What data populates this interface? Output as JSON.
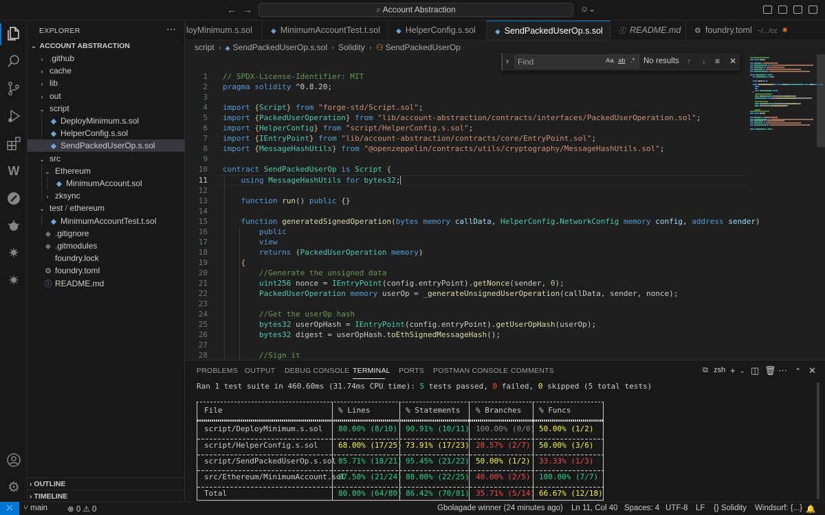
{
  "window": {
    "search_label": "Account Abstraction",
    "copilot_icon": "copilot-icon"
  },
  "activity_bar": [
    "files-icon",
    "search-icon",
    "source-control-icon",
    "run-debug-icon",
    "extensions-icon",
    "windsurf-icon",
    "foundry-icon",
    "remote-explorer-icon",
    "sparkle-icon",
    "sparkle-icon-2",
    "account-icon",
    "settings-gear-icon"
  ],
  "sidebar": {
    "title": "EXPLORER",
    "root": "ACCOUNT ABSTRACTION",
    "items": [
      {
        "label": ".github",
        "kind": "folder",
        "expanded": false,
        "depth": 0
      },
      {
        "label": "cache",
        "kind": "folder",
        "expanded": false,
        "depth": 0
      },
      {
        "label": "lib",
        "kind": "folder",
        "expanded": false,
        "depth": 0
      },
      {
        "label": "out",
        "kind": "folder",
        "expanded": false,
        "depth": 0
      },
      {
        "label": "script",
        "kind": "folder",
        "expanded": true,
        "depth": 0
      },
      {
        "label": "DeployMinimum.s.sol",
        "kind": "sol",
        "depth": 1
      },
      {
        "label": "HelperConfig.s.sol",
        "kind": "sol",
        "depth": 1
      },
      {
        "label": "SendPackedUserOp.s.sol",
        "kind": "sol",
        "depth": 1,
        "selected": true
      },
      {
        "label": "src",
        "kind": "folder",
        "expanded": true,
        "depth": 0
      },
      {
        "label": "Ethereum",
        "kind": "folder",
        "expanded": true,
        "depth": 1
      },
      {
        "label": "MinimumAccount.sol",
        "kind": "sol",
        "depth": 2
      },
      {
        "label": "zksync",
        "kind": "folder",
        "expanded": false,
        "depth": 1
      },
      {
        "label": "test",
        "label2": "ethereum",
        "kind": "folder",
        "expanded": true,
        "depth": 0
      },
      {
        "label": "MinimumAccountTest.t.sol",
        "kind": "sol",
        "depth": 1
      },
      {
        "label": ".gitignore",
        "kind": "git",
        "depth": 0
      },
      {
        "label": ".gitmodules",
        "kind": "git",
        "depth": 0
      },
      {
        "label": "foundry.lock",
        "kind": "plain",
        "depth": 0
      },
      {
        "label": "foundry.toml",
        "kind": "gear",
        "depth": 0
      },
      {
        "label": "README.md",
        "kind": "info",
        "depth": 0
      }
    ],
    "outline_label": "OUTLINE",
    "timeline_label": "TIMELINE"
  },
  "tabs": [
    {
      "label": "loyMinimum.s.sol",
      "icon": "solidity-icon",
      "active": false
    },
    {
      "label": "MinimumAccountTest.t.sol",
      "icon": "solidity-icon",
      "active": false
    },
    {
      "label": "HelperConfig.s.sol",
      "icon": "solidity-icon",
      "active": false
    },
    {
      "label": "SendPackedUserOp.s.sol",
      "icon": "solidity-icon",
      "active": true
    },
    {
      "label": "README.md",
      "icon": "info-icon",
      "active": false,
      "italic": true
    },
    {
      "label": "foundry.toml",
      "suffix": "~/.../cc",
      "icon": "gear-icon",
      "active": false
    }
  ],
  "breadcrumbs": [
    "script",
    "SendPackedUserOp.s.sol",
    "Solidity",
    "SendPackedUserOp"
  ],
  "find": {
    "placeholder": "Find",
    "result": "No results",
    "options": [
      "Aa",
      "ab",
      ".*"
    ]
  },
  "editor": {
    "current_line": 11,
    "lines": [
      [
        [
          "c",
          "// SPDX-License-Identifier: MIT"
        ]
      ],
      [
        [
          "k",
          "pragma"
        ],
        [
          "p",
          " "
        ],
        [
          "k",
          "solidity"
        ],
        [
          "p",
          " ^0.8.20;"
        ]
      ],
      [],
      [
        [
          "k",
          "import"
        ],
        [
          "p",
          " "
        ],
        [
          "b",
          "{"
        ],
        [
          "t",
          "Script"
        ],
        [
          "b",
          "}"
        ],
        [
          "p",
          " "
        ],
        [
          "k",
          "from"
        ],
        [
          "p",
          " "
        ],
        [
          "s",
          "\"forge-std/Script.sol\""
        ],
        [
          "p",
          ";"
        ]
      ],
      [
        [
          "k",
          "import"
        ],
        [
          "p",
          " "
        ],
        [
          "b",
          "{"
        ],
        [
          "t",
          "PackedUserOperation"
        ],
        [
          "b",
          "}"
        ],
        [
          "p",
          " "
        ],
        [
          "k",
          "from"
        ],
        [
          "p",
          " "
        ],
        [
          "s",
          "\"lib/account-abstraction/contracts/interfaces/PackedUserOperation.sol\""
        ],
        [
          "p",
          ";"
        ]
      ],
      [
        [
          "k",
          "import"
        ],
        [
          "p",
          " "
        ],
        [
          "b",
          "{"
        ],
        [
          "t",
          "HelperConfig"
        ],
        [
          "b",
          "}"
        ],
        [
          "p",
          " "
        ],
        [
          "k",
          "from"
        ],
        [
          "p",
          " "
        ],
        [
          "s",
          "\"script/HelperConfig.s.sol\""
        ],
        [
          "p",
          ";"
        ]
      ],
      [
        [
          "k",
          "import"
        ],
        [
          "p",
          " "
        ],
        [
          "b",
          "{"
        ],
        [
          "t",
          "IEntryPoint"
        ],
        [
          "b",
          "}"
        ],
        [
          "p",
          " "
        ],
        [
          "k",
          "from"
        ],
        [
          "p",
          " "
        ],
        [
          "s",
          "\"lib/account-abstraction/contracts/core/EntryPoint.sol\""
        ],
        [
          "p",
          ";"
        ]
      ],
      [
        [
          "k",
          "import"
        ],
        [
          "p",
          " "
        ],
        [
          "b",
          "{"
        ],
        [
          "t",
          "MessageHashUtils"
        ],
        [
          "b",
          "}"
        ],
        [
          "p",
          " "
        ],
        [
          "k",
          "from"
        ],
        [
          "p",
          " "
        ],
        [
          "s",
          "\"@openzeppelin/contracts/utils/cryptography/MessageHashUtils.sol\""
        ],
        [
          "p",
          ";"
        ]
      ],
      [],
      [
        [
          "k",
          "contract"
        ],
        [
          "p",
          " "
        ],
        [
          "t",
          "SendPackedUserOp"
        ],
        [
          "p",
          " "
        ],
        [
          "k",
          "is"
        ],
        [
          "p",
          " "
        ],
        [
          "t",
          "Script"
        ],
        [
          "p",
          " "
        ],
        [
          "b",
          "{"
        ]
      ],
      [
        [
          "p",
          "    "
        ],
        [
          "k",
          "using"
        ],
        [
          "p",
          " "
        ],
        [
          "t",
          "MessageHashUtils"
        ],
        [
          "p",
          " "
        ],
        [
          "k",
          "for"
        ],
        [
          "p",
          " "
        ],
        [
          "t",
          "bytes32"
        ],
        [
          "p",
          ";"
        ]
      ],
      [],
      [
        [
          "p",
          "    "
        ],
        [
          "k",
          "function"
        ],
        [
          "p",
          " "
        ],
        [
          "f",
          "run"
        ],
        [
          "p",
          "() "
        ],
        [
          "k",
          "public"
        ],
        [
          "p",
          " {}"
        ]
      ],
      [],
      [
        [
          "p",
          "    "
        ],
        [
          "k",
          "function"
        ],
        [
          "p",
          " "
        ],
        [
          "f",
          "generatedSignedOperation"
        ],
        [
          "p",
          "("
        ],
        [
          "k",
          "bytes"
        ],
        [
          "p",
          " "
        ],
        [
          "k",
          "memory"
        ],
        [
          "p",
          " "
        ],
        [
          "v",
          "callData"
        ],
        [
          "p",
          ", "
        ],
        [
          "t",
          "HelperConfig"
        ],
        [
          "p",
          "."
        ],
        [
          "t",
          "NetworkConfig"
        ],
        [
          "p",
          " "
        ],
        [
          "k",
          "memory"
        ],
        [
          "p",
          " "
        ],
        [
          "v",
          "config"
        ],
        [
          "p",
          ", "
        ],
        [
          "k",
          "address"
        ],
        [
          "p",
          " "
        ],
        [
          "v",
          "sender"
        ],
        [
          "p",
          ")"
        ]
      ],
      [
        [
          "p",
          "        "
        ],
        [
          "k",
          "public"
        ]
      ],
      [
        [
          "p",
          "        "
        ],
        [
          "k",
          "view"
        ]
      ],
      [
        [
          "p",
          "        "
        ],
        [
          "k",
          "returns"
        ],
        [
          "p",
          " ("
        ],
        [
          "t",
          "PackedUserOperation"
        ],
        [
          "p",
          " "
        ],
        [
          "k",
          "memory"
        ],
        [
          "p",
          ")"
        ]
      ],
      [
        [
          "p",
          "    "
        ],
        [
          "b",
          "{"
        ]
      ],
      [
        [
          "p",
          "        "
        ],
        [
          "c",
          "//Generate the unsigned data"
        ]
      ],
      [
        [
          "p",
          "        "
        ],
        [
          "t",
          "uint256"
        ],
        [
          "p",
          " nonce = "
        ],
        [
          "t",
          "IEntryPoint"
        ],
        [
          "p",
          "(config.entryPoint)."
        ],
        [
          "f",
          "getNonce"
        ],
        [
          "p",
          "(sender, "
        ],
        [
          "n",
          "0"
        ],
        [
          "p",
          ");"
        ]
      ],
      [
        [
          "p",
          "        "
        ],
        [
          "t",
          "PackedUserOperation"
        ],
        [
          "p",
          " "
        ],
        [
          "k",
          "memory"
        ],
        [
          "p",
          " userOp = "
        ],
        [
          "f",
          "_generateUnsignedUserOperation"
        ],
        [
          "p",
          "(callData, sender, nonce);"
        ]
      ],
      [],
      [
        [
          "p",
          "        "
        ],
        [
          "c",
          "//Get the userOp hash"
        ]
      ],
      [
        [
          "p",
          "        "
        ],
        [
          "t",
          "bytes32"
        ],
        [
          "p",
          " userOpHash = "
        ],
        [
          "t",
          "IEntryPoint"
        ],
        [
          "p",
          "(config.entryPoint)."
        ],
        [
          "f",
          "getUserOpHash"
        ],
        [
          "p",
          "(userOp);"
        ]
      ],
      [
        [
          "p",
          "        "
        ],
        [
          "t",
          "bytes32"
        ],
        [
          "p",
          " digest = userOpHash."
        ],
        [
          "f",
          "toEthSignedMessageHash"
        ],
        [
          "p",
          "();"
        ]
      ],
      [],
      [
        [
          "p",
          "        "
        ],
        [
          "c",
          "//Sign it"
        ]
      ]
    ]
  },
  "panel": {
    "tabs": [
      "PROBLEMS",
      "OUTPUT",
      "DEBUG CONSOLE",
      "TERMINAL",
      "PORTS",
      "POSTMAN CONSOLE",
      "COMMENTS"
    ],
    "active_tab": "TERMINAL",
    "shell": "zsh",
    "summary_parts": [
      [
        "p",
        "Ran 1 test suite in 460.60ms (31.74ms CPU time): "
      ],
      [
        "g",
        "5"
      ],
      [
        "p",
        " tests passed, "
      ],
      [
        "r",
        "0"
      ],
      [
        "p",
        " failed, "
      ],
      [
        "y",
        "0"
      ],
      [
        "p",
        " skipped (5 total tests)"
      ]
    ],
    "coverage": {
      "headers": [
        "File",
        "% Lines",
        "% Statements",
        "% Branches",
        "% Funcs"
      ],
      "rows": [
        {
          "file": "script/DeployMinimum.s.sol",
          "cells": [
            [
              "80.00% (8/10)",
              "g"
            ],
            [
              "90.91% (10/11)",
              "g"
            ],
            [
              "100.00% (0/0)",
              "x"
            ],
            [
              "50.00% (1/2)",
              "y"
            ]
          ]
        },
        {
          "file": "script/HelperConfig.s.sol",
          "cells": [
            [
              "68.00% (17/25)",
              "y"
            ],
            [
              "73.91% (17/23)",
              "y"
            ],
            [
              "28.57% (2/7)",
              "r"
            ],
            [
              "50.00% (3/6)",
              "y"
            ]
          ]
        },
        {
          "file": "script/SendPackedUserOp.s.sol",
          "cells": [
            [
              "85.71% (18/21)",
              "g"
            ],
            [
              "95.45% (21/22)",
              "g"
            ],
            [
              "50.00% (1/2)",
              "y"
            ],
            [
              "33.33% (1/3)",
              "r"
            ]
          ]
        },
        {
          "file": "src/Ethereum/MinimumAccount.sol",
          "cells": [
            [
              "87.50% (21/24)",
              "g"
            ],
            [
              "88.00% (22/25)",
              "g"
            ],
            [
              "40.00% (2/5)",
              "r"
            ],
            [
              "100.00% (7/7)",
              "g"
            ]
          ]
        },
        {
          "file": "Total",
          "cells": [
            [
              "80.00% (64/80)",
              "g"
            ],
            [
              "86.42% (70/81)",
              "g"
            ],
            [
              "35.71% (5/14)",
              "r"
            ],
            [
              "66.67% (12/18)",
              "y"
            ]
          ]
        }
      ]
    }
  },
  "status": {
    "branch": "main",
    "errors": "0",
    "warnings": "0",
    "blame": "Gbolagade winner (24 minutes ago)",
    "position": "Ln 11, Col 40",
    "spaces": "Spaces: 4",
    "encoding": "UTF-8",
    "eol": "LF",
    "language": "Solidity",
    "windsurf": "Windsurf: {...}"
  },
  "colors": {
    "accent": "#0078d4",
    "pass": "#23d18b",
    "warn": "#f5f543",
    "fail": "#f14c4c"
  }
}
